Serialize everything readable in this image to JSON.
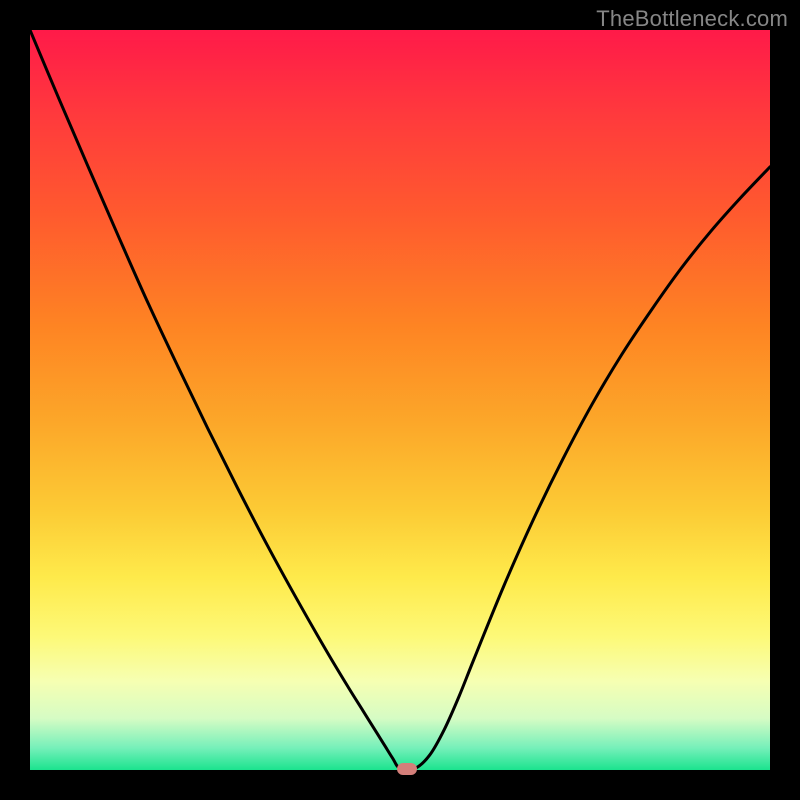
{
  "watermark": "TheBottleneck.com",
  "chart_data": {
    "type": "line",
    "title": "",
    "xlabel": "",
    "ylabel": "",
    "xlim": [
      0,
      1
    ],
    "ylim": [
      0,
      1
    ],
    "grid": false,
    "legend": false,
    "series": [
      {
        "name": "curve",
        "color": "#000000",
        "x": [
          0.0,
          0.04,
          0.08,
          0.12,
          0.16,
          0.2,
          0.24,
          0.28,
          0.32,
          0.36,
          0.4,
          0.43,
          0.45,
          0.47,
          0.48,
          0.49,
          0.5,
          0.52,
          0.54,
          0.56,
          0.58,
          0.6,
          0.64,
          0.68,
          0.72,
          0.76,
          0.8,
          0.84,
          0.88,
          0.92,
          0.96,
          1.0
        ],
        "y": [
          1.0,
          0.905,
          0.812,
          0.72,
          0.63,
          0.545,
          0.462,
          0.382,
          0.305,
          0.232,
          0.162,
          0.112,
          0.08,
          0.048,
          0.032,
          0.016,
          0.002,
          0.002,
          0.02,
          0.055,
          0.1,
          0.15,
          0.248,
          0.338,
          0.42,
          0.495,
          0.562,
          0.622,
          0.678,
          0.728,
          0.773,
          0.815
        ]
      }
    ],
    "marker": {
      "x": 0.51,
      "y": 0.002,
      "color": "#d47f7a"
    },
    "background_gradient": {
      "stops": [
        {
          "pos": 0.0,
          "color": "#ff1a49"
        },
        {
          "pos": 0.12,
          "color": "#ff3b3c"
        },
        {
          "pos": 0.25,
          "color": "#ff5a2e"
        },
        {
          "pos": 0.4,
          "color": "#fe8423"
        },
        {
          "pos": 0.53,
          "color": "#fca729"
        },
        {
          "pos": 0.65,
          "color": "#fccb35"
        },
        {
          "pos": 0.74,
          "color": "#feea4b"
        },
        {
          "pos": 0.82,
          "color": "#fdf978"
        },
        {
          "pos": 0.88,
          "color": "#f6ffb2"
        },
        {
          "pos": 0.93,
          "color": "#d6fcc4"
        },
        {
          "pos": 0.97,
          "color": "#76f0ba"
        },
        {
          "pos": 1.0,
          "color": "#1be38e"
        }
      ]
    }
  }
}
